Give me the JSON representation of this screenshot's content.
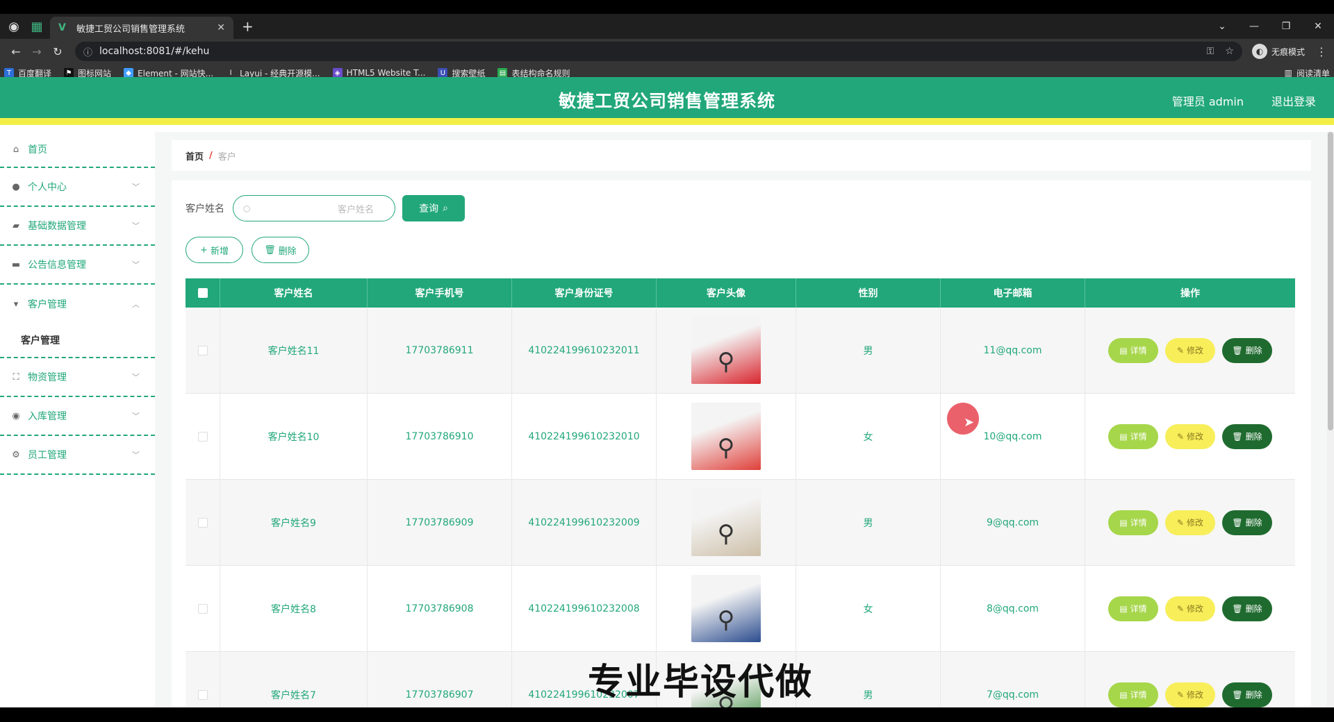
{
  "browser": {
    "tab_title": "敏捷工贸公司销售管理系统",
    "url": "localhost:8081/#/kehu",
    "profile_label": "无痕模式",
    "reading_list": "阅读清单",
    "bookmarks": [
      "百度翻译",
      "图标网站",
      "Element - 网站快...",
      "Layui - 经典开源模...",
      "HTML5 Website T...",
      "搜索壁纸",
      "表结构命名规则"
    ]
  },
  "header": {
    "title": "敏捷工贸公司销售管理系统",
    "user": "管理员 admin",
    "logout": "退出登录"
  },
  "sidebar": {
    "home": "首页",
    "personal": "个人中心",
    "basic": "基础数据管理",
    "notice": "公告信息管理",
    "customer": "客户管理",
    "customer_sub": "客户管理",
    "goods": "物资管理",
    "stock": "入库管理",
    "staff": "员工管理"
  },
  "breadcrumb": {
    "home": "首页",
    "sep": "/",
    "current": "客户"
  },
  "search": {
    "label": "客户姓名",
    "placeholder": "客户姓名",
    "button": "查询"
  },
  "actions": {
    "add": "新增",
    "delete": "删除"
  },
  "table": {
    "headers": [
      "客户姓名",
      "客户手机号",
      "客户身份证号",
      "客户头像",
      "性别",
      "电子邮箱",
      "操作"
    ],
    "ops": {
      "detail": "详情",
      "edit": "修改",
      "delete": "删除"
    },
    "rows": [
      {
        "name": "客户姓名11",
        "phone": "17703786911",
        "idcard": "410224199610232011",
        "gender": "男",
        "email": "11@qq.com",
        "img_color": "#d8262e"
      },
      {
        "name": "客户姓名10",
        "phone": "17703786910",
        "idcard": "410224199610232010",
        "gender": "女",
        "email": "10@qq.com",
        "img_color": "#e0403a"
      },
      {
        "name": "客户姓名9",
        "phone": "17703786909",
        "idcard": "410224199610232009",
        "gender": "男",
        "email": "9@qq.com",
        "img_color": "#cdbfa8"
      },
      {
        "name": "客户姓名8",
        "phone": "17703786908",
        "idcard": "410224199610232008",
        "gender": "女",
        "email": "8@qq.com",
        "img_color": "#2c4d8f"
      },
      {
        "name": "客户姓名7",
        "phone": "17703786907",
        "idcard": "410224199610232007",
        "gender": "男",
        "email": "7@qq.com",
        "img_color": "#3a8a3a"
      }
    ]
  },
  "watermark": "专业毕设代做",
  "colors": {
    "primary": "#21a77a",
    "accent_yellow": "#f3ee47",
    "detail": "#a6d64a",
    "edit": "#f7ee5a",
    "delete": "#1f6b2f"
  }
}
